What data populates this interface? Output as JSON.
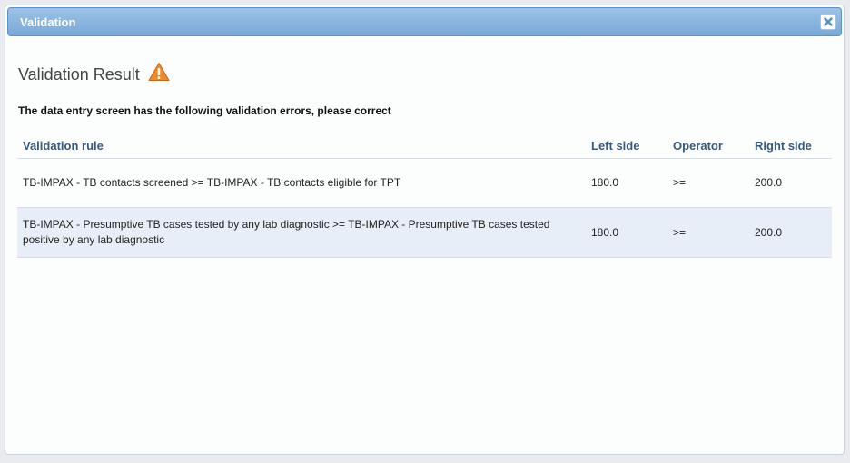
{
  "dialog": {
    "title": "Validation"
  },
  "result": {
    "heading": "Validation Result",
    "message": "The data entry screen has the following validation errors, please correct"
  },
  "table": {
    "headers": {
      "rule": "Validation rule",
      "left": "Left side",
      "operator": "Operator",
      "right": "Right side"
    },
    "rows": [
      {
        "rule": "TB-IMPAX - TB contacts screened >= TB-IMPAX - TB contacts eligible for TPT",
        "left": "180.0",
        "operator": ">=",
        "right": "200.0"
      },
      {
        "rule": "TB-IMPAX - Presumptive TB cases tested by any lab diagnostic >= TB-IMPAX - Presumptive TB cases tested positive by any lab diagnostic",
        "left": "180.0",
        "operator": ">=",
        "right": "200.0"
      }
    ]
  },
  "icons": {
    "close": "close-icon",
    "warning": "warning-icon"
  },
  "colors": {
    "titlebar": "#79a9d8",
    "warning": "#f08a24",
    "header_text": "#39597a",
    "row_alt": "#e8eef8"
  }
}
